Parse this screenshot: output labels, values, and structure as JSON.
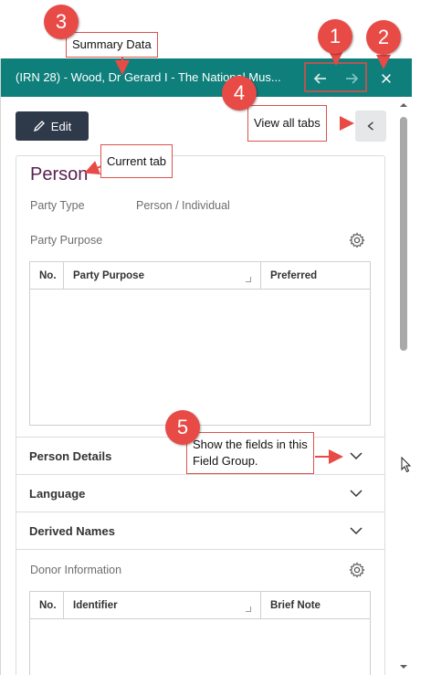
{
  "window": {
    "title": "(IRN 28) - Wood, Dr Gerard I - The National Mus...",
    "back_icon": "arrow-left-icon",
    "forward_icon": "arrow-right-icon",
    "close_icon": "close-icon"
  },
  "toolbar": {
    "edit_label": "Edit",
    "view_tabs_icon": "chevron-left-icon"
  },
  "record": {
    "tab_title": "Person",
    "party_type_label": "Party Type",
    "party_type_value": "Person / Individual",
    "party_purpose_label": "Party Purpose",
    "party_purpose_table": {
      "columns": [
        "No.",
        "Party Purpose",
        "Preferred"
      ],
      "rows": []
    },
    "sections": [
      "Person Details",
      "Language",
      "Derived Names"
    ],
    "donor_info_label": "Donor Information",
    "donor_table": {
      "columns": [
        "No.",
        "Identifier",
        "Brief Note"
      ],
      "rows": []
    }
  },
  "annotations": {
    "badges": [
      "1",
      "2",
      "3",
      "4",
      "5"
    ],
    "summary_data": "Summary Data",
    "current_tab": "Current tab",
    "view_all_tabs": "View all tabs",
    "show_fields": "Show the fields in this Field Group.",
    "color": "#e84a46"
  },
  "colors": {
    "titlebar": "#0f7f7b",
    "edit_button": "#2e3a4a",
    "tab_title": "#5a2050"
  }
}
